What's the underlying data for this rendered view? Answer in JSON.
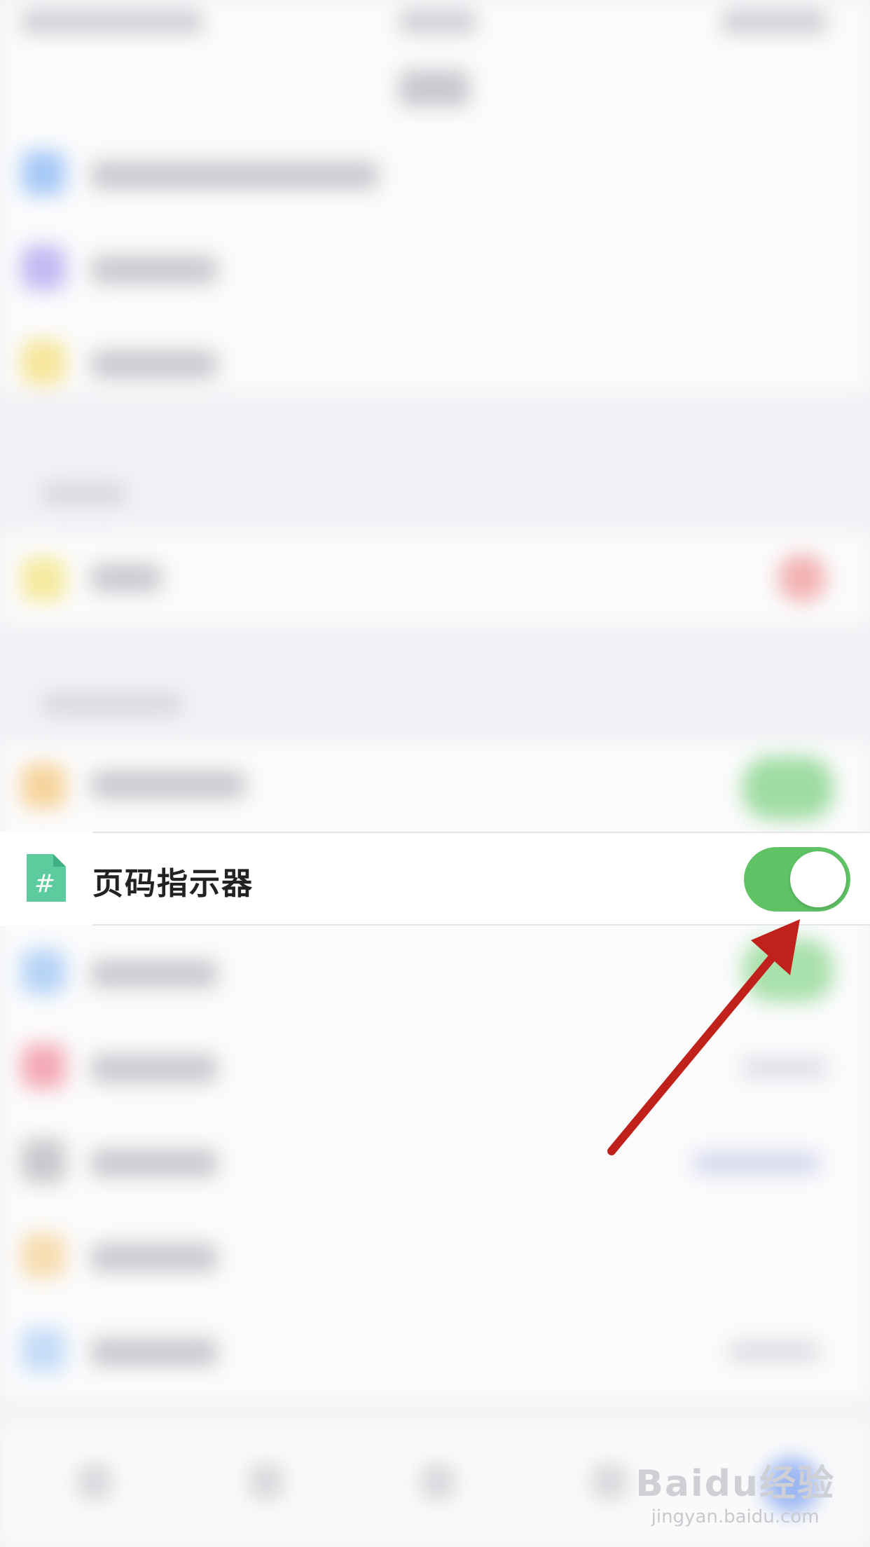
{
  "focus_row": {
    "icon": "page-number-doc-icon",
    "icon_glyph": "#",
    "label": "页码指示器",
    "toggle_on": true
  },
  "colors": {
    "toggle_on": "#5fc265",
    "icon_green": "#5ccb9e",
    "arrow": "#c0211a"
  },
  "watermark": {
    "logo": "Baidu经验",
    "url": "jingyan.baidu.com"
  }
}
